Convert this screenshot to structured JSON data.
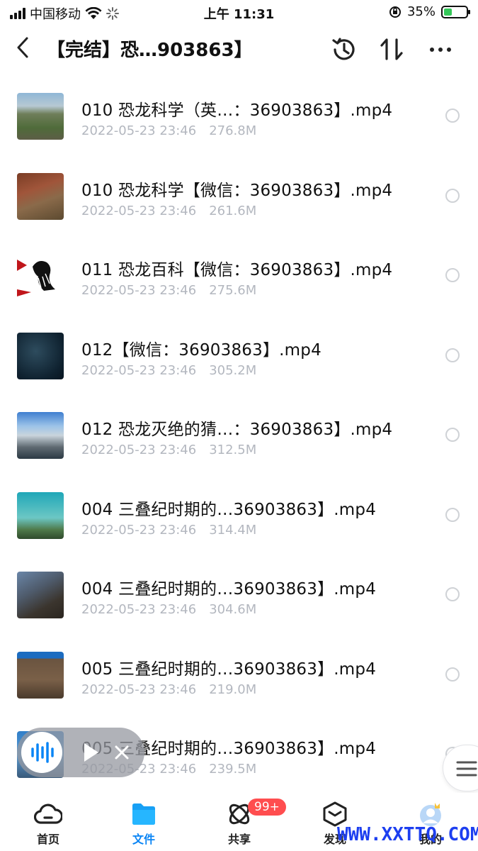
{
  "status_bar": {
    "carrier": "中国移动",
    "time": "上午 11:31",
    "battery": "35%",
    "battery_level": 0.35
  },
  "navbar": {
    "title": "【完结】恐…903863】"
  },
  "files": [
    {
      "name": "010 恐龙科学（英…：36903863】.mp4",
      "date": "2022-05-23 23:46",
      "size": "276.8M"
    },
    {
      "name": "010 恐龙科学【微信：36903863】.mp4",
      "date": "2022-05-23 23:46",
      "size": "261.6M"
    },
    {
      "name": "011 恐龙百科【微信：36903863】.mp4",
      "date": "2022-05-23 23:46",
      "size": "275.6M"
    },
    {
      "name": "012【微信：36903863】.mp4",
      "date": "2022-05-23 23:46",
      "size": "305.2M"
    },
    {
      "name": "012 恐龙灭绝的猜…：36903863】.mp4",
      "date": "2022-05-23 23:46",
      "size": "312.5M"
    },
    {
      "name": "004 三叠纪时期的…36903863】.mp4",
      "date": "2022-05-23 23:46",
      "size": "314.4M"
    },
    {
      "name": "004 三叠纪时期的…36903863】.mp4",
      "date": "2022-05-23 23:46",
      "size": "304.6M"
    },
    {
      "name": "005 三叠纪时期的…36903863】.mp4",
      "date": "2022-05-23 23:46",
      "size": "219.0M"
    },
    {
      "name": "005 三叠纪时期的…36903863】.mp4",
      "date": "2022-05-23 23:46",
      "size": "239.5M"
    }
  ],
  "tabbar": {
    "tabs": [
      {
        "label": "首页",
        "icon": "cloud-icon"
      },
      {
        "label": "文件",
        "icon": "folder-icon"
      },
      {
        "label": "共享",
        "icon": "atom-icon"
      },
      {
        "label": "发现",
        "icon": "box-icon"
      },
      {
        "label": "我的",
        "icon": "avatar-icon"
      }
    ],
    "share_badge": "99+"
  },
  "watermark": "WWW.XXTTQ.COM",
  "colors": {
    "accent": "#0a85f5",
    "badge": "#ff4d4f",
    "meta_text": "#b3b7bf",
    "battery_fill": "#34c759"
  }
}
